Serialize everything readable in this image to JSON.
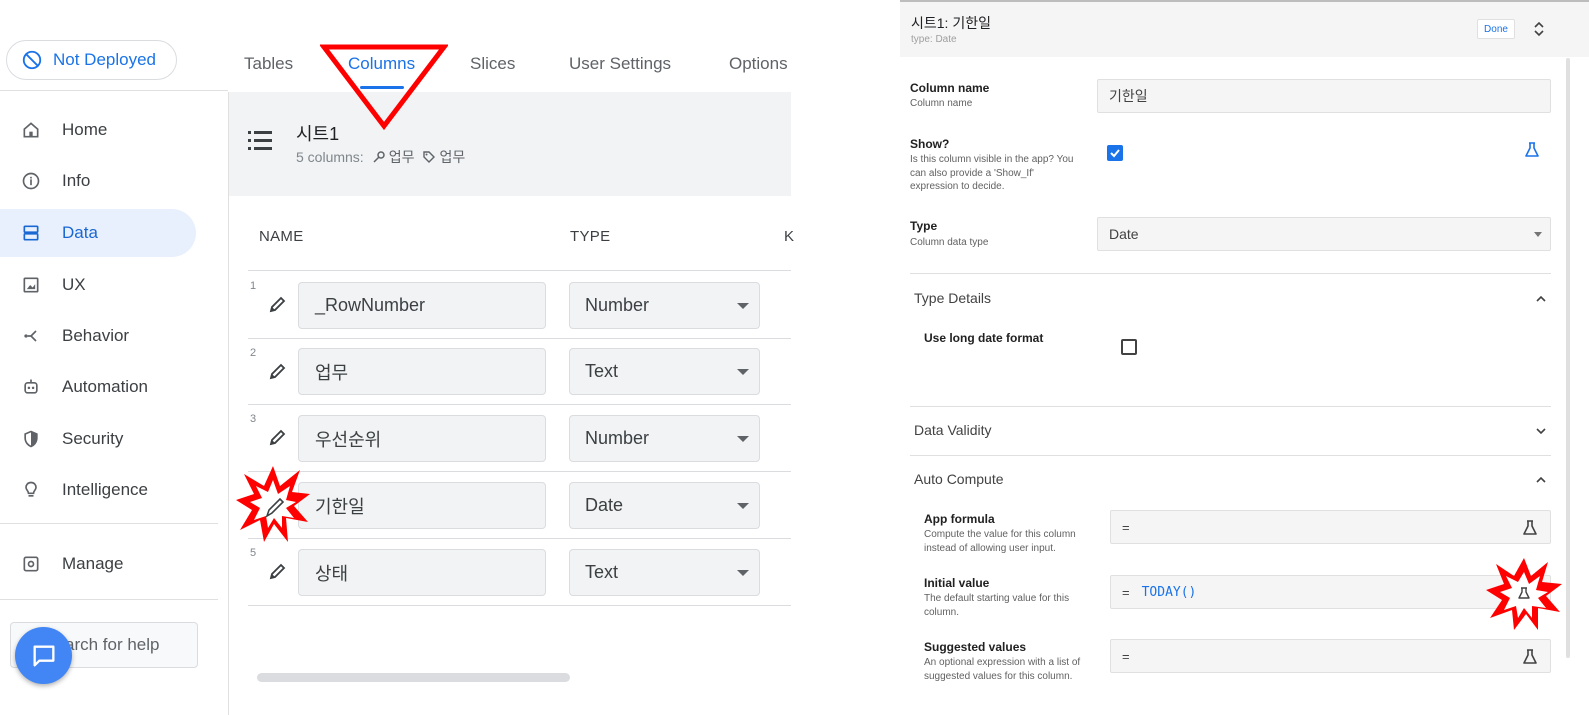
{
  "left": {
    "deploy_status": "Not Deployed",
    "tabs": [
      {
        "label": "Tables",
        "active": false
      },
      {
        "label": "Columns",
        "active": true
      },
      {
        "label": "Slices",
        "active": false
      },
      {
        "label": "User Settings",
        "active": false
      },
      {
        "label": "Options",
        "active": false
      }
    ],
    "sidebar": {
      "items": [
        {
          "label": "Home",
          "icon": "home-icon",
          "active": false
        },
        {
          "label": "Info",
          "icon": "info-icon",
          "active": false
        },
        {
          "label": "Data",
          "icon": "data-icon",
          "active": true
        },
        {
          "label": "UX",
          "icon": "ux-icon",
          "active": false
        },
        {
          "label": "Behavior",
          "icon": "behavior-icon",
          "active": false
        },
        {
          "label": "Automation",
          "icon": "automation-icon",
          "active": false
        },
        {
          "label": "Security",
          "icon": "shield-icon",
          "active": false
        },
        {
          "label": "Intelligence",
          "icon": "lightbulb-icon",
          "active": false
        }
      ],
      "manage_label": "Manage",
      "help_placeholder": "arch for help"
    },
    "table": {
      "title": "시트1",
      "columns_count": "5 columns:",
      "key_chip": "업무",
      "label_chip": "업무",
      "headers": {
        "name": "NAME",
        "type": "TYPE",
        "key": "K"
      },
      "rows": [
        {
          "num": "1",
          "name": "_RowNumber",
          "type": "Number"
        },
        {
          "num": "2",
          "name": "업무",
          "type": "Text"
        },
        {
          "num": "3",
          "name": "우선순위",
          "type": "Number"
        },
        {
          "num": "",
          "name": "기한일",
          "type": "Date"
        },
        {
          "num": "5",
          "name": "상태",
          "type": "Text"
        }
      ]
    }
  },
  "right": {
    "title": "시트1: 기한일",
    "subtitle": "type: Date",
    "done_label": "Done",
    "fields": {
      "column_name": {
        "label": "Column name",
        "help": "Column name",
        "value": "기한일"
      },
      "show": {
        "label": "Show?",
        "help": "Is this column visible in the app? You can also provide a 'Show_If' expression to decide.",
        "checked": true
      },
      "type": {
        "label": "Type",
        "help": "Column data type",
        "value": "Date"
      }
    },
    "sections": {
      "type_details": "Type Details",
      "long_date_label": "Use long date format",
      "data_validity": "Data Validity",
      "auto_compute": "Auto Compute"
    },
    "auto": {
      "app_formula": {
        "label": "App formula",
        "help": "Compute the value for this column instead of allowing user input.",
        "eq": "=",
        "value": ""
      },
      "initial_value": {
        "label": "Initial value",
        "help": "The default starting value for this column.",
        "eq": "=",
        "value": "TODAY()"
      },
      "suggested": {
        "label": "Suggested values",
        "help": "An optional expression with a list of suggested values for this column.",
        "eq": "=",
        "value": ""
      }
    }
  },
  "colors": {
    "accent": "#1a73e8",
    "annotation_red": "#ff0000",
    "active_bg": "#e8f0fe"
  }
}
